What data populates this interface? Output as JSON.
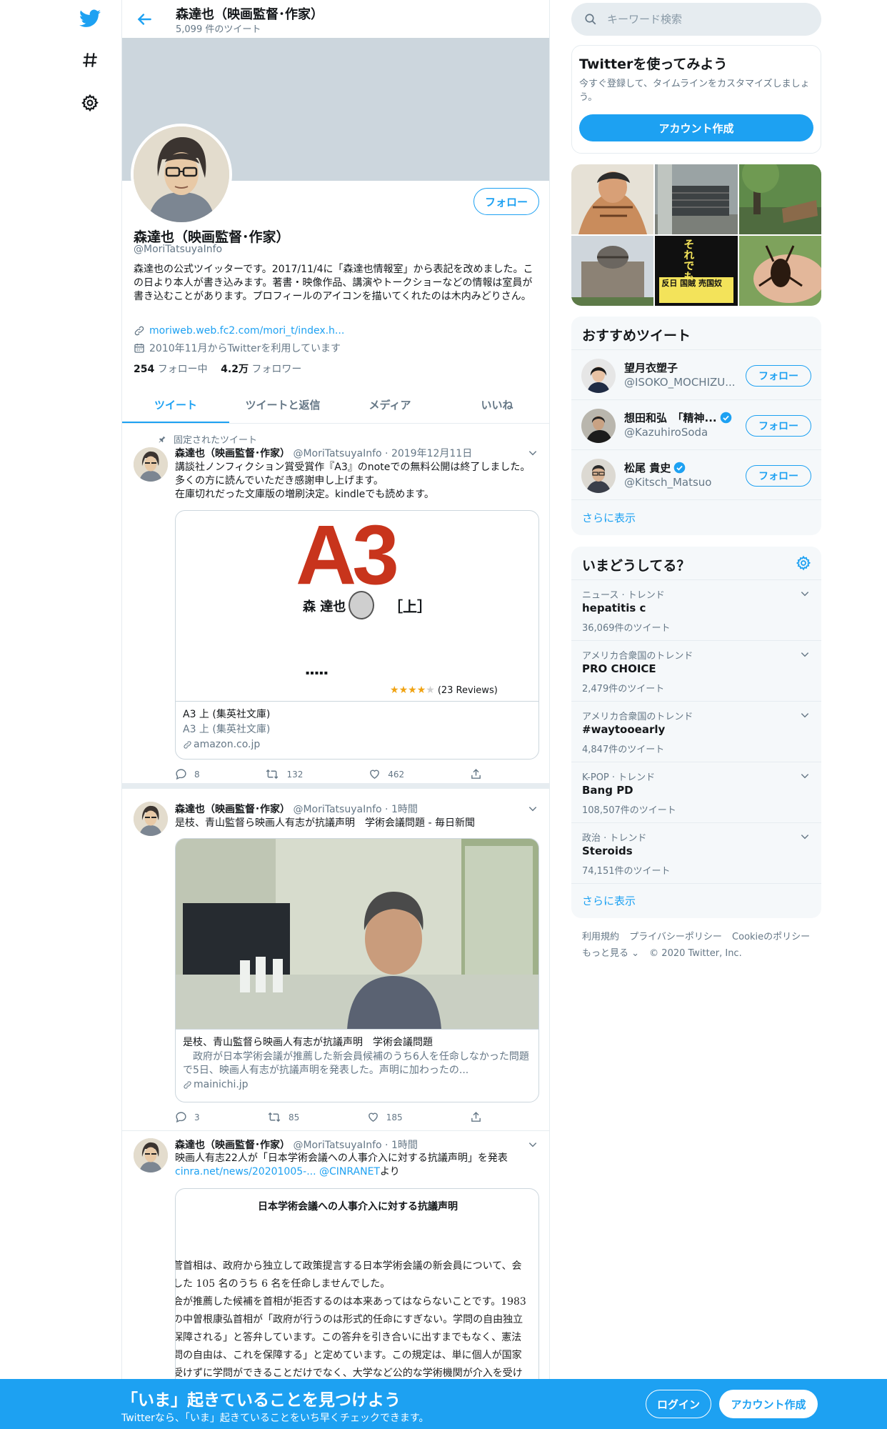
{
  "header": {
    "name": "森達也（映画監督･作家）",
    "tweet_count": "5,099 件のツイート"
  },
  "profile": {
    "follow_label": "フォロー",
    "name": "森達也（映画監督･作家）",
    "handle": "@MoriTatsuyaInfo",
    "bio": "森達也の公式ツイッターです。2017/11/4に「森達也情報室」から表記を改めました。この日より本人が書き込みます。著書・映像作品、講演やトークショーなどの情報は室員が書き込むことがあります。プロフィールのアイコンを描いてくれたのは木内みどりさん。",
    "link": "moriweb.web.fc2.com/mori_t/index.h...",
    "joined": "2010年11月からTwitterを利用しています",
    "following_count": "254",
    "following_label": "フォロー中",
    "followers_count": "4.2万",
    "followers_label": "フォロワー"
  },
  "tabs": [
    "ツイート",
    "ツイートと返信",
    "メディア",
    "いいね"
  ],
  "tweets": [
    {
      "pinned_label": "固定されたツイート",
      "name": "森達也（映画監督･作家）",
      "handle": "@MoriTatsuyaInfo",
      "date": "2019年12月11日",
      "text": "講談社ノンフィクション賞受賞作『A3』のnoteでの無料公開は終了しました。多くの方に読んでいただき感謝申し上げます。\n在庫切れだった文庫版の増刷決定。kindleでも読めます。",
      "card": {
        "cover_title": "A3",
        "cover_author": "森 達也",
        "cover_volume": "［上］",
        "cover_dots": "▪▪▪▪▪",
        "reviews": "(23 Reviews)",
        "stars": "★★★★★",
        "rating": 4,
        "title": "A3 上 (集英社文庫)",
        "desc": "A3 上 (集英社文庫)",
        "domain": "amazon.co.jp"
      },
      "replies": "8",
      "retweets": "132",
      "likes": "462"
    },
    {
      "name": "森達也（映画監督･作家）",
      "handle": "@MoriTatsuyaInfo",
      "date": "1時間",
      "text": "是枝、青山監督ら映画人有志が抗議声明　学術会議問題 - 毎日新聞",
      "card": {
        "title": "是枝、青山監督ら映画人有志が抗議声明　学術会議問題",
        "desc": "政府が日本学術会議が推薦した新会員候補のうち6人を任命しなかった問題で5日、映画人有志が抗議声明を発表した。声明に加わったの...",
        "domain": "mainichi.jp"
      },
      "replies": "3",
      "retweets": "85",
      "likes": "185"
    },
    {
      "name": "森達也（映画監督･作家）",
      "handle": "@MoriTatsuyaInfo",
      "date": "1時間",
      "text": "映画人有志22人が「日本学術会議への人事介入に対する抗議声明」を発表",
      "link": "cinra.net/news/20201005-...",
      "mention": "@CINRANET",
      "suffix": "より",
      "doc": {
        "title": "日本学術会議への人事介入に対する抗議声明",
        "lines": [
          "菅首相は、政府から独立して政策提言する日本学術会議の新会員について、会",
          "した 105 名のうち 6 名を任命しませんでした。",
          "会が推薦した候補を首相が拒否するのは本来あってはならないことです。1983",
          "の中曽根康弘首相が「政府が行うのは形式的任命にすぎない。学問の自由独立",
          "保障される」と答弁しています。この答弁を引き合いに出すまでもなく、憲法",
          "問の自由は、これを保障する」と定めています。この規定は、単に個人が国家",
          "受けずに学問ができることだけでなく、大学など公的な学術機関が介入を受け"
        ]
      }
    }
  ],
  "sidebar": {
    "search_placeholder": "キーワード検索",
    "signup": {
      "title": "Twitterを使ってみよう",
      "desc": "今すぐ登録して、タイムラインをカスタマイズしましょう。",
      "button": "アカウント作成"
    },
    "media_book1": "それでも",
    "media_book2": "反日 国賊 売国奴",
    "recommended": {
      "title": "おすすめツイート",
      "users": [
        {
          "name": "望月衣塑子",
          "handle": "@ISOKO_MOCHIZU...",
          "verified": false,
          "follow": "フォロー"
        },
        {
          "name": "想田和弘　「精神...",
          "handle": "@KazuhiroSoda",
          "verified": true,
          "follow": "フォロー"
        },
        {
          "name": "松尾 貴史",
          "handle": "@Kitsch_Matsuo",
          "verified": true,
          "follow": "フォロー"
        }
      ],
      "more": "さらに表示"
    },
    "trends": {
      "title": "いまどうしてる？",
      "items": [
        {
          "category": "ニュース · トレンド",
          "name": "hepatitis c",
          "count": "36,069件のツイート"
        },
        {
          "category": "アメリカ合衆国のトレンド",
          "name": "PRO CHOICE",
          "count": "2,479件のツイート"
        },
        {
          "category": "アメリカ合衆国のトレンド",
          "name": "#waytooearly",
          "count": "4,847件のツイート"
        },
        {
          "category": "K-POP · トレンド",
          "name": "Bang PD",
          "count": "108,507件のツイート"
        },
        {
          "category": "政治 · トレンド",
          "name": "Steroids",
          "count": "74,151件のツイート"
        }
      ],
      "more": "さらに表示"
    },
    "footer": {
      "terms": "利用規約",
      "privacy": "プライバシーポリシー",
      "cookie": "Cookieのポリシー",
      "more": "もっと見る ⌄",
      "copyright": "© 2020 Twitter, Inc."
    }
  },
  "bottombar": {
    "title": "「いま」起きていることを見つけよう",
    "subtitle": "Twitterなら、「いま」起きていることをいち早くチェックできます。",
    "login": "ログイン",
    "signup": "アカウント作成"
  },
  "colors": {
    "accent": "#1da1f2",
    "banner": "#ccd6dd",
    "text": "#14171a",
    "muted": "#657786",
    "border": "#e6ecf0"
  }
}
